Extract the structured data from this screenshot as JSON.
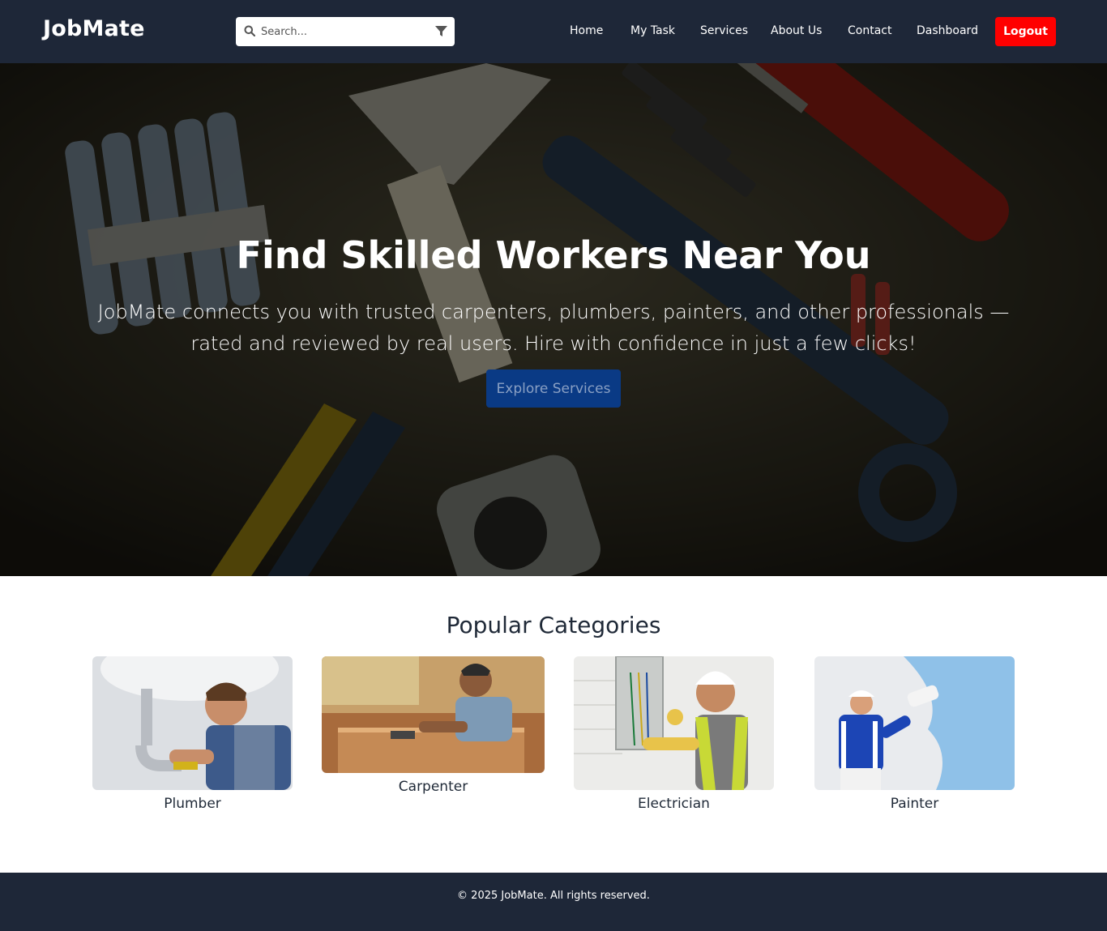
{
  "header": {
    "brand": "JobMate",
    "search": {
      "placeholder": "Search..."
    },
    "nav": [
      {
        "label": "Home"
      },
      {
        "label": "My Task"
      },
      {
        "label": "Services"
      },
      {
        "label": "About Us"
      },
      {
        "label": "Contact"
      },
      {
        "label": "Dashboard"
      }
    ],
    "logout_label": "Logout"
  },
  "hero": {
    "title": "Find Skilled Workers Near You",
    "subtitle": "JobMate connects you with trusted carpenters, plumbers, painters, and other professionals — rated and reviewed by real users. Hire with confidence in just a few clicks!",
    "cta_label": "Explore Services"
  },
  "categories": {
    "title": "Popular Categories",
    "items": [
      {
        "label": "Plumber"
      },
      {
        "label": "Carpenter"
      },
      {
        "label": "Electrician"
      },
      {
        "label": "Painter"
      }
    ]
  },
  "footer": {
    "copyright": "© 2025 JobMate. All rights reserved."
  },
  "colors": {
    "header_bg": "#1e2738",
    "logout_bg": "#ff0000",
    "cta_bg": "#0a3a85"
  }
}
